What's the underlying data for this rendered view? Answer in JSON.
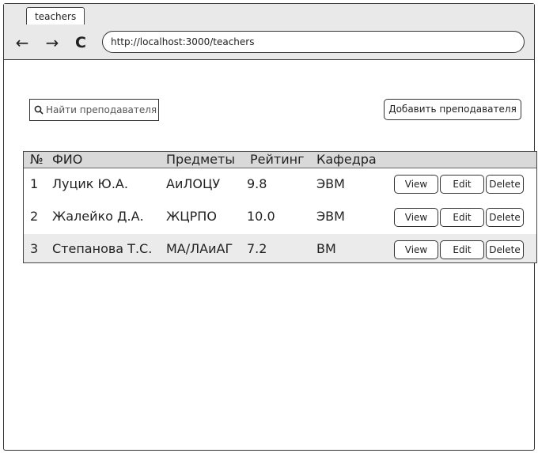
{
  "browser": {
    "tab_title": "teachers",
    "url": "http://localhost:3000/teachers",
    "back_icon": "←",
    "forward_icon": "→",
    "reload_icon": "C"
  },
  "toolbar": {
    "search_placeholder": "Найти преподавателя",
    "add_button": "Добавить преподавателя"
  },
  "table": {
    "headers": [
      "№",
      "ФИО",
      "Предметы",
      "Рейтинг",
      "Кафедра"
    ],
    "rows": [
      {
        "num": "1",
        "name": "Луцик Ю.А.",
        "subjects": "АиЛОЦУ",
        "rating": "9.8",
        "department": "ЭВМ"
      },
      {
        "num": "2",
        "name": "Жалейко Д.А.",
        "subjects": "ЖЦРПО",
        "rating": "10.0",
        "department": "ЭВМ"
      },
      {
        "num": "3",
        "name": "Степанова Т.С.",
        "subjects": "МА/ЛАиАГ",
        "rating": "7.2",
        "department": "ВМ"
      }
    ],
    "actions": {
      "view": "View",
      "edit": "Edit",
      "delete": "Delete"
    }
  },
  "colors": {
    "chrome": "#e9e9e9",
    "header_row": "#d9d9d9",
    "zebra_row": "#ebebeb"
  }
}
